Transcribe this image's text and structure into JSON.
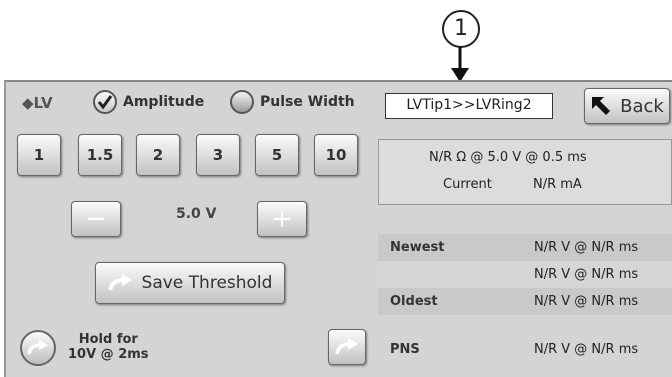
{
  "callout": {
    "number": "1"
  },
  "header": {
    "lead_label": "LV",
    "amplitude_label": "Amplitude",
    "pulse_width_label": "Pulse Width",
    "selected_mode": "Amplitude",
    "lead_config": "LVTip1>>LVRing2",
    "back_label": "Back"
  },
  "amplitude_buttons": [
    "1",
    "1.5",
    "2",
    "3",
    "5",
    "10"
  ],
  "stepper": {
    "minus": "−",
    "plus": "+",
    "value": "5.0 V"
  },
  "save_threshold_label": "Save Threshold",
  "hold": {
    "line1": "Hold for",
    "line2": "10V @ 2ms"
  },
  "summary": {
    "impedance_line": "N/R Ω @ 5.0 V @ 0.5 ms",
    "current_label": "Current",
    "current_value": "N/R  mA"
  },
  "history": [
    {
      "label": "Newest",
      "value": "N/R V @ N/R ms"
    },
    {
      "label": "",
      "value": "N/R V @ N/R ms"
    },
    {
      "label": "Oldest",
      "value": "N/R V @ N/R ms"
    },
    {
      "label": "PNS",
      "value": "N/R V @ N/R ms"
    }
  ],
  "icons": [
    "lead-diamond-icon",
    "check-icon",
    "back-arrow-icon",
    "save-arrow-icon",
    "hold-arrow-icon",
    "pns-arrow-icon"
  ]
}
